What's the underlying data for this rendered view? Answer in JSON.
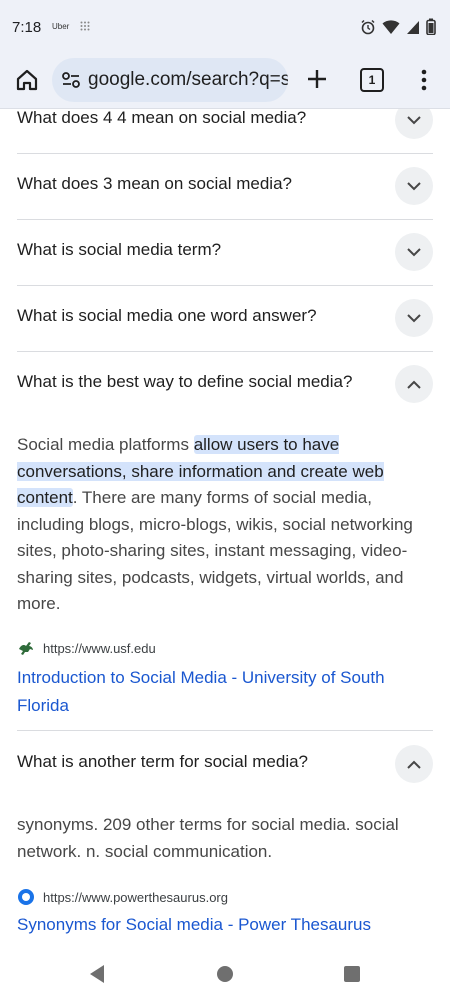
{
  "status_bar": {
    "time": "7:18",
    "app": "Uber",
    "icons": [
      "grid-icon",
      "alarm-icon",
      "wifi-icon",
      "signal-icon",
      "battery-icon"
    ]
  },
  "toolbar": {
    "url": "google.com/search?q=so",
    "tab_count": "1",
    "icons": [
      "home-icon",
      "tune-icon",
      "plus-icon",
      "tabs-icon",
      "menu-icon"
    ]
  },
  "questions": [
    {
      "label": "What does 4 4 mean on social media?",
      "expanded": false
    },
    {
      "label": "What does 3 mean on social media?",
      "expanded": false
    },
    {
      "label": "What is social media term?",
      "expanded": false
    },
    {
      "label": "What is social media one word answer?",
      "expanded": false
    },
    {
      "label": "What is the best way to define social media?",
      "expanded": true
    },
    {
      "label": "What is another term for social media?",
      "expanded": true
    }
  ],
  "answers": [
    {
      "before": "Social media platforms ",
      "highlight": "allow users to have conversations, share information and create web content",
      "after": ". There are many forms of social media, including blogs, micro-blogs, wikis, social networking sites, photo-sharing sites, instant messaging, video-sharing sites, podcasts, widgets, virtual worlds, and more.",
      "source_url": "https://www.usf.edu",
      "link_title": "Introduction to Social Media - University of South Florida"
    },
    {
      "text": "synonyms. 209 other terms for social media. social network. n. social communication.",
      "source_url": "https://www.powerthesaurus.org",
      "link_title": "Synonyms for Social media - Power Thesaurus"
    }
  ],
  "colors": {
    "link": "#1a57d0",
    "highlight": "#d4e3fb",
    "chrome_bg": "#eef1f8"
  }
}
